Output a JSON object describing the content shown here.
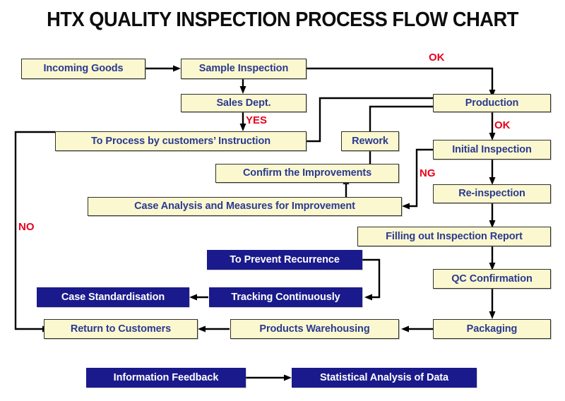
{
  "title": "HTX QUALITY INSPECTION PROCESS FLOW CHART",
  "colors": {
    "cream_fill": "#fbf8d0",
    "cream_text": "#2b3a8f",
    "cream_border": "#30302a",
    "navy_fill": "#1a1a8c",
    "navy_text": "#ffffff",
    "label_red": "#e8001c",
    "title_black": "#0d0d0d",
    "connector": "#000000",
    "background": "#ffffff"
  },
  "chart_data": {
    "type": "diagram",
    "title": "HTX QUALITY INSPECTION PROCESS FLOW CHART",
    "nodes": [
      {
        "id": "incoming_goods",
        "label": "Incoming Goods",
        "style": "cream"
      },
      {
        "id": "sample_inspection",
        "label": "Sample Inspection",
        "style": "cream"
      },
      {
        "id": "sales_dept",
        "label": "Sales Dept.",
        "style": "cream"
      },
      {
        "id": "to_process",
        "label": "To Process by customers’ Instruction",
        "style": "cream"
      },
      {
        "id": "production",
        "label": "Production",
        "style": "cream"
      },
      {
        "id": "rework",
        "label": "Rework",
        "style": "cream"
      },
      {
        "id": "initial_inspection",
        "label": "Initial Inspection",
        "style": "cream"
      },
      {
        "id": "confirm_improvements",
        "label": "Confirm the Improvements",
        "style": "cream"
      },
      {
        "id": "re_inspection",
        "label": "Re-inspection",
        "style": "cream"
      },
      {
        "id": "case_analysis",
        "label": "Case Analysis and Measures for Improvement",
        "style": "cream"
      },
      {
        "id": "filling_report",
        "label": "Filling out Inspection Report",
        "style": "cream"
      },
      {
        "id": "prevent_recurrence",
        "label": "To Prevent Recurrence",
        "style": "navy"
      },
      {
        "id": "qc_confirmation",
        "label": "QC Confirmation",
        "style": "cream"
      },
      {
        "id": "case_standardisation",
        "label": "Case Standardisation",
        "style": "navy"
      },
      {
        "id": "tracking_continuously",
        "label": "Tracking Continuously",
        "style": "navy"
      },
      {
        "id": "return_customers",
        "label": "Return to Customers",
        "style": "cream"
      },
      {
        "id": "products_warehousing",
        "label": "Products Warehousing",
        "style": "cream"
      },
      {
        "id": "packaging",
        "label": "Packaging",
        "style": "cream"
      },
      {
        "id": "information_feedback",
        "label": "Information Feedback",
        "style": "navy"
      },
      {
        "id": "statistical_analysis",
        "label": "Statistical Analysis of Data",
        "style": "navy"
      }
    ],
    "edge_labels": [
      {
        "id": "ok_top",
        "text": "OK"
      },
      {
        "id": "yes",
        "text": "YES"
      },
      {
        "id": "ok_production",
        "text": "OK"
      },
      {
        "id": "ng",
        "text": "NG"
      },
      {
        "id": "no",
        "text": "NO"
      }
    ],
    "edges": [
      {
        "from": "incoming_goods",
        "to": "sample_inspection",
        "label": ""
      },
      {
        "from": "sample_inspection",
        "to": "production",
        "label": "OK"
      },
      {
        "from": "sample_inspection",
        "to": "sales_dept",
        "label": ""
      },
      {
        "from": "sales_dept",
        "to": "to_process",
        "label": "YES"
      },
      {
        "from": "to_process",
        "to": "production",
        "label": ""
      },
      {
        "from": "to_process",
        "to": "return_customers",
        "label": "NO"
      },
      {
        "from": "production",
        "to": "initial_inspection",
        "label": "OK"
      },
      {
        "from": "initial_inspection",
        "to": "re_inspection",
        "label": ""
      },
      {
        "from": "initial_inspection",
        "to": "case_analysis",
        "label": "NG"
      },
      {
        "from": "case_analysis",
        "to": "confirm_improvements",
        "label": ""
      },
      {
        "from": "confirm_improvements",
        "to": "rework",
        "label": ""
      },
      {
        "from": "rework",
        "to": "production",
        "label": ""
      },
      {
        "from": "re_inspection",
        "to": "filling_report",
        "label": ""
      },
      {
        "from": "filling_report",
        "to": "qc_confirmation",
        "label": ""
      },
      {
        "from": "qc_confirmation",
        "to": "packaging",
        "label": ""
      },
      {
        "from": "packaging",
        "to": "products_warehousing",
        "label": ""
      },
      {
        "from": "products_warehousing",
        "to": "return_customers",
        "label": ""
      },
      {
        "from": "prevent_recurrence",
        "to": "tracking_continuously",
        "label": ""
      },
      {
        "from": "tracking_continuously",
        "to": "case_standardisation",
        "label": ""
      },
      {
        "from": "information_feedback",
        "to": "statistical_analysis",
        "label": ""
      }
    ]
  },
  "nodes": {
    "incoming_goods": "Incoming Goods",
    "sample_inspection": "Sample Inspection",
    "sales_dept": "Sales Dept.",
    "to_process": "To Process by customers’ Instruction",
    "production": "Production",
    "rework": "Rework",
    "initial_inspection": "Initial Inspection",
    "confirm_improvements": "Confirm the Improvements",
    "re_inspection": "Re-inspection",
    "case_analysis": "Case Analysis and Measures for Improvement",
    "filling_report": "Filling out Inspection Report",
    "prevent_recurrence": "To Prevent Recurrence",
    "qc_confirmation": "QC Confirmation",
    "case_standardisation": "Case Standardisation",
    "tracking_continuously": "Tracking Continuously",
    "return_customers": "Return to Customers",
    "products_warehousing": "Products Warehousing",
    "packaging": "Packaging",
    "information_feedback": "Information Feedback",
    "statistical_analysis": "Statistical Analysis of Data"
  },
  "labels": {
    "ok_top": "OK",
    "yes": "YES",
    "ok_production": "OK",
    "ng": "NG",
    "no": "NO"
  }
}
